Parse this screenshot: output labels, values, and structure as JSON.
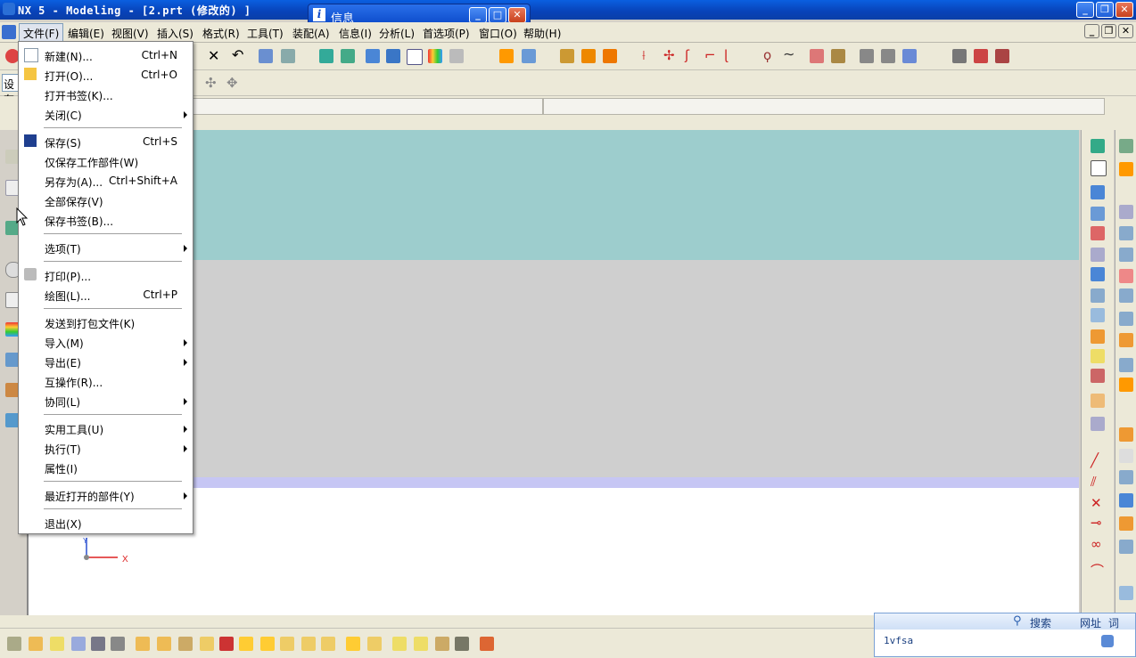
{
  "window": {
    "title": "NX 5 - Modeling - [2.prt  (修改的) ]"
  },
  "info_popup": {
    "title": "信息"
  },
  "menubar": {
    "items": [
      {
        "label": "文件(F)"
      },
      {
        "label": "编辑(E)"
      },
      {
        "label": "视图(V)"
      },
      {
        "label": "插入(S)"
      },
      {
        "label": "格式(R)"
      },
      {
        "label": "工具(T)"
      },
      {
        "label": "装配(A)"
      },
      {
        "label": "信息(I)"
      },
      {
        "label": "分析(L)"
      },
      {
        "label": "首选项(P)"
      },
      {
        "label": "窗口(O)"
      },
      {
        "label": "帮助(H)"
      }
    ]
  },
  "toolbar2": {
    "combo_text": "设有"
  },
  "file_menu": {
    "items": [
      {
        "label": "新建(N)...",
        "shortcut": "Ctrl+N",
        "icon": "new-file-icon"
      },
      {
        "label": "打开(O)...",
        "shortcut": "Ctrl+O",
        "icon": "open-folder-icon"
      },
      {
        "label": "打开书签(K)..."
      },
      {
        "label": "关闭(C)",
        "submenu": true
      },
      {
        "label": "保存(S)",
        "shortcut": "Ctrl+S",
        "icon": "save-icon"
      },
      {
        "label": "仅保存工作部件(W)"
      },
      {
        "label": "另存为(A)...",
        "shortcut": "Ctrl+Shift+A"
      },
      {
        "label": "全部保存(V)"
      },
      {
        "label": "保存书签(B)..."
      },
      {
        "label": "选项(T)",
        "submenu": true
      },
      {
        "label": "打印(P)...",
        "icon": "printer-icon"
      },
      {
        "label": "绘图(L)...",
        "shortcut": "Ctrl+P"
      },
      {
        "label": "发送到打包文件(K)"
      },
      {
        "label": "导入(M)",
        "submenu": true
      },
      {
        "label": "导出(E)",
        "submenu": true
      },
      {
        "label": "互操作(R)..."
      },
      {
        "label": "协同(L)",
        "submenu": true
      },
      {
        "label": "实用工具(U)",
        "submenu": true
      },
      {
        "label": "执行(T)",
        "submenu": true
      },
      {
        "label": "属性(I)"
      },
      {
        "label": "最近打开的部件(Y)",
        "submenu": true
      },
      {
        "label": "退出(X)"
      }
    ]
  },
  "graphics": {
    "axis_x_label": "X",
    "axis_y_label": "Y",
    "colors": {
      "teal": "#9dcdcd",
      "gray": "#cfcfcf",
      "lavender": "#c6c6f4"
    }
  },
  "search_widget": {
    "search_label": "搜索",
    "url_label": "网址",
    "word_label": "词",
    "input_value": "1vfsa"
  }
}
